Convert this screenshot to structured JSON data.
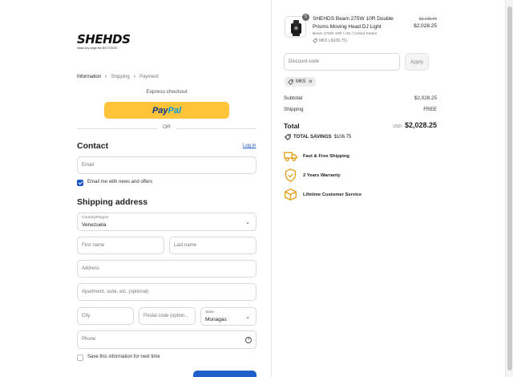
{
  "brand": {
    "logo_text": "SHEHDS",
    "tagline": "Make any stage like BIG STAGE"
  },
  "breadcrumb": {
    "items": [
      "Information",
      "Shipping",
      "Payment"
    ]
  },
  "express": {
    "label": "Express checkout",
    "paypal_part1": "Pay",
    "paypal_part2": "Pal",
    "or": "OR"
  },
  "contact": {
    "title": "Contact",
    "login_link": "Log in",
    "email_placeholder": "Email",
    "newsletter_label": "Email me with news and offers",
    "newsletter_checked": true
  },
  "shipping": {
    "title": "Shipping address",
    "country_label": "Country/Region",
    "country_value": "Venezuela",
    "first_name_placeholder": "First name",
    "last_name_placeholder": "Last name",
    "address_placeholder": "Address",
    "apartment_placeholder": "Apartment, suite, etc. (optional)",
    "city_placeholder": "City",
    "postal_placeholder": "Postal code (option...",
    "state_label": "State",
    "state_value": "Monagas",
    "phone_placeholder": "Phone",
    "save_info_label": "Save this information for next time",
    "save_info_checked": false
  },
  "order": {
    "product": {
      "quantity": "5",
      "name": "SHEHDS Beam 275W 10R Double Prisms Moving Head DJ Light",
      "variant": "Beam 275W 10R / US / United States",
      "discount_note": "MK5 (-$106.75)",
      "old_price": "$2,135.00",
      "price": "$2,028.25"
    },
    "discount_placeholder": "Discount code",
    "apply_label": "Apply",
    "applied_code": "MK5",
    "subtotal_label": "Subtotal",
    "subtotal_value": "$2,028.25",
    "shipping_label": "Shipping",
    "shipping_value": "FREE",
    "total_label": "Total",
    "currency": "USD",
    "total_value": "$2,028.25",
    "savings_label": "TOTAL SAVINGS",
    "savings_value": "$106.75"
  },
  "features": [
    {
      "label": "Fast & Free Shipping",
      "icon": "truck-icon"
    },
    {
      "label": "2 Years Warranty",
      "icon": "warranty-shield-icon"
    },
    {
      "label": "Lifetime Customer Service",
      "icon": "package-icon"
    }
  ],
  "colors": {
    "paypal_yellow": "#ffc439",
    "link_blue": "#1a55c4",
    "feature_gold": "#e0a21a",
    "button_blue": "#1f5fc8"
  }
}
